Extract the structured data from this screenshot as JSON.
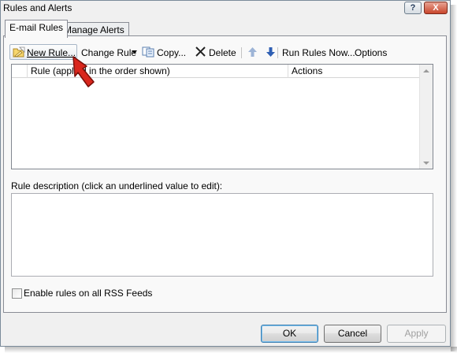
{
  "window": {
    "title": "Rules and Alerts",
    "help_label": "?",
    "close_label": "X"
  },
  "tabs": [
    {
      "label": "E-mail Rules",
      "active": true
    },
    {
      "label": "Manage Alerts",
      "active": false
    }
  ],
  "toolbar": {
    "new_rule": "New Rule...",
    "change_rule": "Change Rule",
    "copy": "Copy...",
    "delete": "Delete",
    "run_rules_now": "Run Rules Now...",
    "options": "Options"
  },
  "rules_list": {
    "columns": [
      "Rule (applied in the order shown)",
      "Actions"
    ],
    "rows": []
  },
  "description": {
    "label": "Rule description (click an underlined value to edit):",
    "value": ""
  },
  "rss": {
    "label": "Enable rules on all RSS Feeds",
    "checked": false
  },
  "buttons": {
    "ok": "OK",
    "cancel": "Cancel",
    "apply": "Apply"
  },
  "colors": {
    "window_bg": "#f0f0f0",
    "annotation_arrow": "#d9261c"
  }
}
